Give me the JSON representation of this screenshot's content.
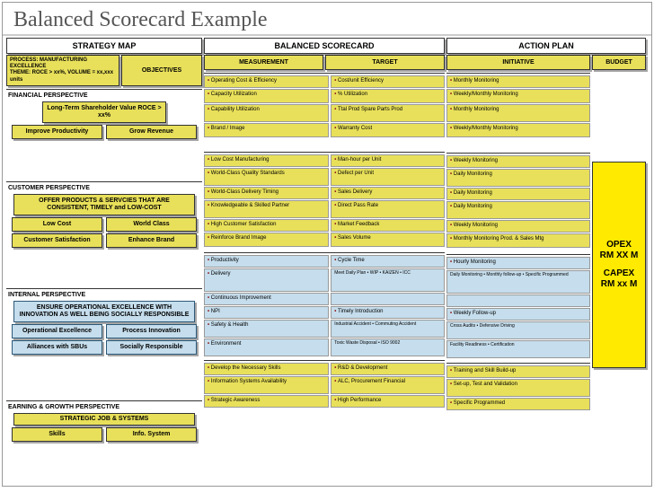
{
  "title": "Balanced Scorecard Example",
  "headers": {
    "strategy": "STRATEGY MAP",
    "bsc": "BALANCED SCORECARD",
    "action": "ACTION PLAN",
    "process": "PROCESS: MANUFACTURING EXCELLENCE",
    "theme": "THEME: ROCE > xx%, VOLUME = xx,xxx units",
    "objectives": "OBJECTIVES",
    "measurement": "MEASUREMENT",
    "target": "TARGET",
    "initiative": "INITIATIVE",
    "budget": "BUDGET"
  },
  "perspectives": {
    "financial": "FINANCIAL PERSPECTIVE",
    "customer": "CUSTOMER PERSPECTIVE",
    "internal": "INTERNAL PERSPECTIVE",
    "earning": "EARNING & GROWTH PERSPECTIVE"
  },
  "strategy": {
    "fin": {
      "top": "Long-Term Shareholder Value ROCE > xx%",
      "b1": "Improve Productivity",
      "b2": "Grow Revenue"
    },
    "cust": {
      "top": "OFFER PRODUCTS & SERVCIES THAT ARE CONSISTENT, TIMELY and LOW-COST",
      "b1": "Low Cost",
      "b2": "World Class",
      "b3": "Customer Satisfaction",
      "b4": "Enhance Brand"
    },
    "int": {
      "top": "ENSURE OPERATIONAL EXCELLENCE WITH INNOVATION AS WELL BEING SOCIALLY RESPONSIBLE",
      "b1": "Operational Excellence",
      "b2": "Process Innovation",
      "b3": "Alliances with SBUs",
      "b4": "Socially Responsible"
    },
    "earn": {
      "top": "STRATEGIC JOB & SYSTEMS",
      "b1": "Skills",
      "b2": "Info. System"
    }
  },
  "objectives": {
    "fin": [
      "Operating Cost & Efficiency",
      "Capacity Utilization",
      "Capability Utilization",
      "Brand / Image"
    ],
    "cust": [
      "Low Cost Manufacturing",
      "World-Class Quality Standards",
      "World-Class Delivery Timing",
      "Knowledgeable & Skilled Partner",
      "High Customer Satisfaction",
      "Reinforce Brand Image"
    ],
    "int": [
      "Productivity",
      "Delivery",
      "Continuous Improvement",
      "NPI",
      "Safety & Health",
      "Environment"
    ],
    "earn": [
      "Develop the Necessary Skills",
      "Information Systems Availability",
      "Strategic Awareness"
    ]
  },
  "measurement": {
    "fin": [
      "Cost/unit Efficiency",
      "% Utilization",
      "Ttal Prod Spare Parts Prod",
      "Warranty Cost"
    ],
    "cust": [
      "Man-hour per Unit",
      "Defect per Unit",
      "Sales Delivery",
      "Direct Pass Rate",
      "Market Feedback",
      "Sales Volume"
    ],
    "int": [
      "Cycle Time",
      "Meet Daily Plan • WIP • KAIZEN • ICC",
      "Timely Introduction",
      "Industrial Accident • Commuting Accident",
      "Toxic Waste Disposal • ISO 9002"
    ],
    "earn": [
      "R&D & Development",
      "ALC, Procurement Financial",
      "High Performance"
    ]
  },
  "target": {
    "fin": [
      "",
      "",
      "",
      ":"
    ]
  },
  "initiative": {
    "fin": [
      "Monthly Monitoring",
      "Weekly/Monthly Monitoring",
      "Monthly Monitoring",
      "Weekly/Monthly Monitoring"
    ],
    "cust": [
      "Weekly Monitoring",
      "Daily Monitoring",
      "Daily Monitoring",
      "Daily Monitoring",
      "Weekly Monitoring",
      "Monthly Monitoring Prod. & Sales Mtg"
    ],
    "int": [
      "Hourly Monitoring",
      "Daily Monitoring • Monthly follow-up • Specific Programmed",
      "Weekly Follow-up",
      "Cross Audits • Defensive Driving",
      "Facility Readiness • Certification"
    ],
    "earn": [
      "Training and Skill Build-up",
      "Set-up, Test and Validation",
      "Specific Programmed"
    ]
  },
  "budget": {
    "opex1": "OPEX",
    "opex2": "RM XX M",
    "capex1": "CAPEX",
    "capex2": "RM xx M"
  }
}
